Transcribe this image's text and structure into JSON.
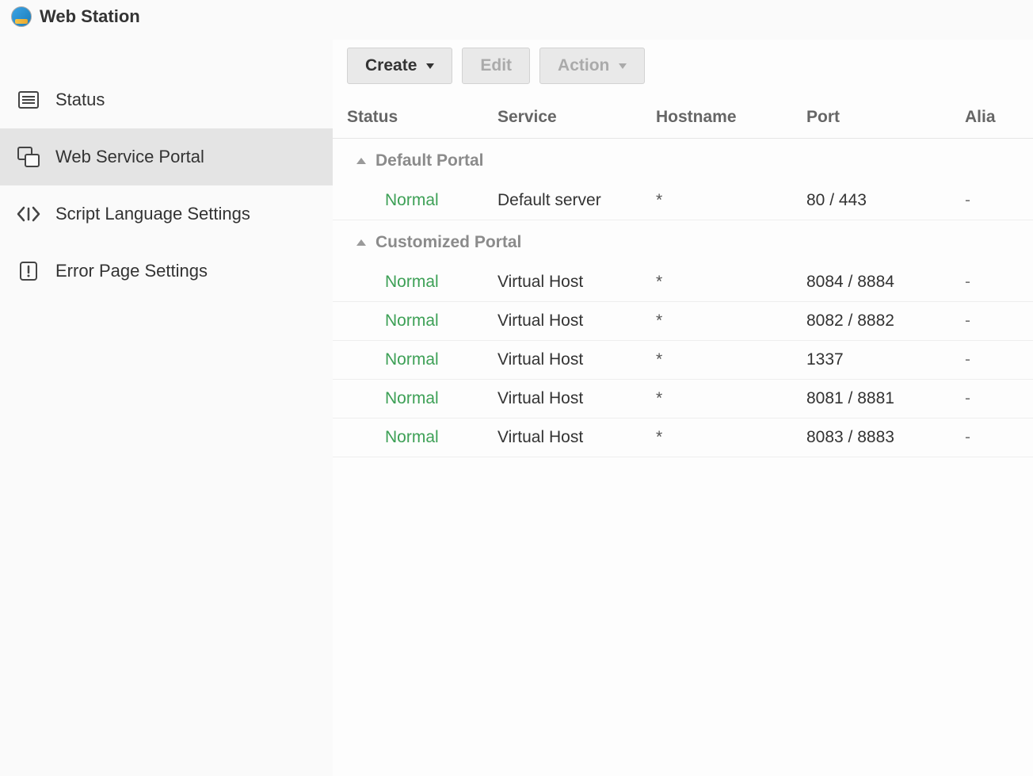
{
  "app_title": "Web Station",
  "sidebar": {
    "items": [
      {
        "label": "Status",
        "selected": false,
        "icon": "list"
      },
      {
        "label": "Web Service Portal",
        "selected": true,
        "icon": "portal"
      },
      {
        "label": "Script Language Settings",
        "selected": false,
        "icon": "code"
      },
      {
        "label": "Error Page Settings",
        "selected": false,
        "icon": "alert"
      }
    ]
  },
  "toolbar": {
    "create_label": "Create",
    "edit_label": "Edit",
    "action_label": "Action"
  },
  "table": {
    "headers": {
      "status": "Status",
      "service": "Service",
      "hostname": "Hostname",
      "port": "Port",
      "alias": "Alia"
    },
    "groups": [
      {
        "title": "Default Portal",
        "rows": [
          {
            "status": "Normal",
            "service": "Default server",
            "hostname": "*",
            "port": "80 / 443",
            "alias": "-"
          }
        ]
      },
      {
        "title": "Customized Portal",
        "rows": [
          {
            "status": "Normal",
            "service": "Virtual Host",
            "hostname": "*",
            "port": "8084 / 8884",
            "alias": "-"
          },
          {
            "status": "Normal",
            "service": "Virtual Host",
            "hostname": "*",
            "port": "8082 / 8882",
            "alias": "-"
          },
          {
            "status": "Normal",
            "service": "Virtual Host",
            "hostname": "*",
            "port": "1337",
            "alias": "-"
          },
          {
            "status": "Normal",
            "service": "Virtual Host",
            "hostname": "*",
            "port": "8081 / 8881",
            "alias": "-"
          },
          {
            "status": "Normal",
            "service": "Virtual Host",
            "hostname": "*",
            "port": "8083 / 8883",
            "alias": "-"
          }
        ]
      }
    ]
  }
}
